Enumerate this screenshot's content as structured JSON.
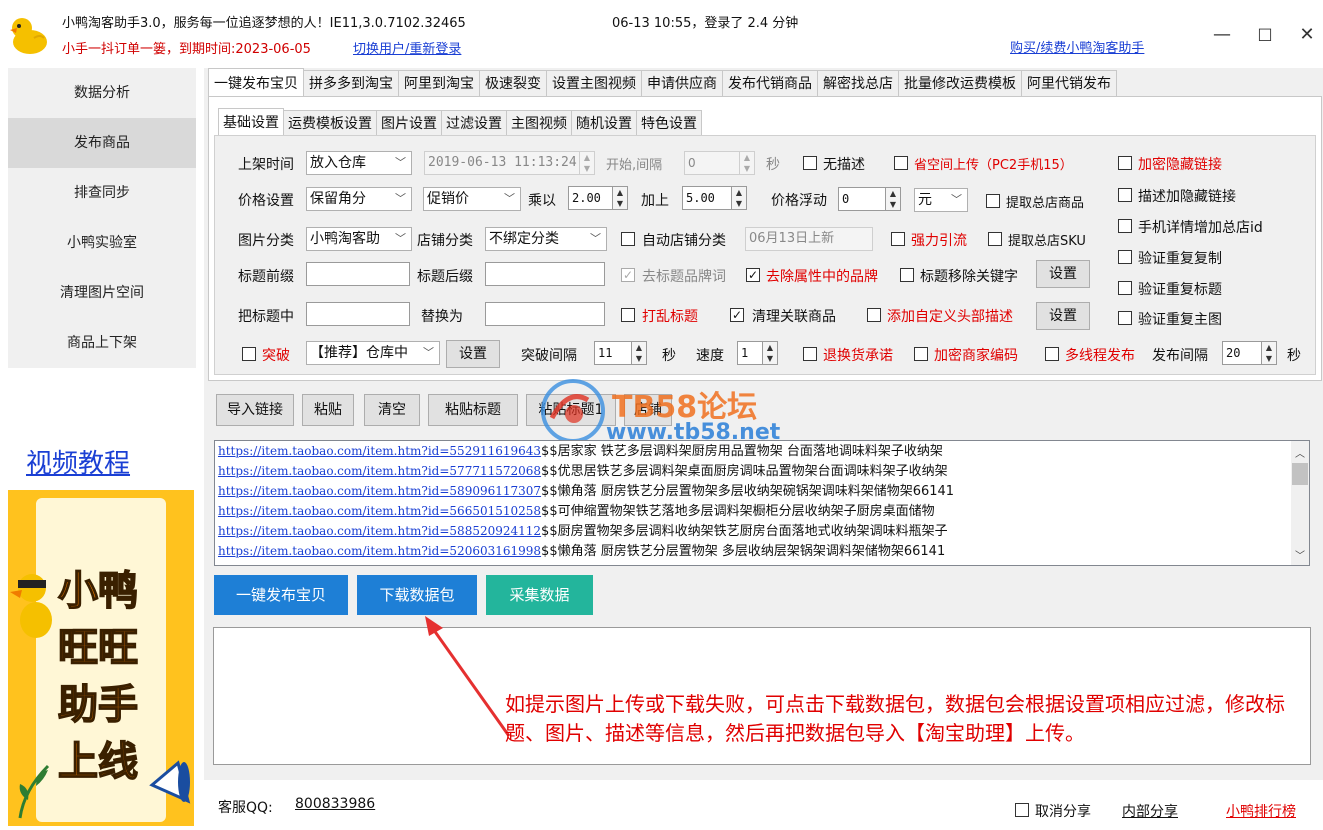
{
  "titlebar": {
    "line1": "小鸭淘客助手3.0，服务每一位追逐梦想的人！IE11,3.0.7102.32465",
    "time_info": "06-13 10:55，登录了 2.4 分钟",
    "line2": "小手一抖订单一篓，到期时间:2023-06-05",
    "switch_user": "切换用户/重新登录",
    "buy": "购买/续费小鸭淘客助手",
    "minimize": "—",
    "maximize": "□",
    "close": "✕"
  },
  "sidebar": {
    "items": [
      {
        "label": "数据分析"
      },
      {
        "label": "发布商品"
      },
      {
        "label": "排查同步"
      },
      {
        "label": "小鸭实验室"
      },
      {
        "label": "清理图片空间"
      },
      {
        "label": "商品上下架"
      }
    ],
    "video_link": "视频教程",
    "banner": {
      "l1": "小鸭",
      "l2": "旺旺",
      "l3": "助手",
      "l4": "上线"
    }
  },
  "tabs": [
    "一键发布宝贝",
    "拼多多到淘宝",
    "阿里到淘宝",
    "极速裂变",
    "设置主图视频",
    "申请供应商",
    "发布代销商品",
    "解密找总店",
    "批量修改运费模板",
    "阿里代销发布"
  ],
  "subtabs": [
    "基础设置",
    "运费模板设置",
    "图片设置",
    "过滤设置",
    "主图视频",
    "随机设置",
    "特色设置"
  ],
  "form": {
    "shelf_time_label": "上架时间",
    "shelf_time_value": "放入仓库",
    "datetime": "2019-06-13 11:13:24",
    "start_interval": "开始,间隔",
    "interval_value": "0",
    "seconds": "秒",
    "no_desc": "无描述",
    "save_space": "省空间上传（PC2手机15）",
    "encrypt_link": "加密隐藏链接",
    "price_label": "价格设置",
    "price_value": "保留角分",
    "promo_value": "促销价",
    "multiply": "乘以",
    "multiply_value": "2.00",
    "add": "加上",
    "add_value": "5.00",
    "float": "价格浮动",
    "float_value": "0",
    "unit": "元",
    "extract_store": "提取总店商品",
    "desc_hidden": "描述加隐藏链接",
    "mobile_detail": "手机详情增加总店id",
    "img_cat_label": "图片分类",
    "img_cat_value": "小鸭淘客助",
    "shop_cat_label": "店铺分类",
    "shop_cat_value": "不绑定分类",
    "auto_shop_cat": "自动店铺分类",
    "new_date": "06月13日上新",
    "strong_drain": "强力引流",
    "extract_sku": "提取总店SKU",
    "verify_copy": "验证重复复制",
    "prefix_label": "标题前缀",
    "suffix_label": "标题后缀",
    "remove_brand": "去标题品牌词",
    "remove_attr_brand": "去除属性中的品牌",
    "remove_keyword": "标题移除关键字",
    "set": "设置",
    "verify_title": "验证重复标题",
    "replace_from": "把标题中",
    "replace_to": "替换为",
    "shuffle_title": "打乱标题",
    "clear_related": "清理关联商品",
    "custom_header": "添加自定义头部描述",
    "verify_img": "验证重复主图",
    "breakthrough": "突破",
    "recommend": "【推荐】仓库中",
    "break_interval": "突破间隔",
    "break_interval_value": "11",
    "speed": "速度",
    "speed_value": "1",
    "return_promise": "退换货承诺",
    "encrypt_code": "加密商家编码",
    "multithread": "多线程发布",
    "publish_interval": "发布间隔",
    "publish_interval_value": "20"
  },
  "toolbar": [
    "导入链接",
    "粘贴",
    "清空",
    "粘贴标题",
    "粘贴标题1",
    "店铺"
  ],
  "watermark": {
    "title": "TB58论坛",
    "url": "www.tb58.net"
  },
  "urls": [
    {
      "url": "https://item.taobao.com/item.htm?id=552911619643",
      "title": "$$居家家 铁艺多层调料架厨房用品置物架 台面落地调味料架子收纳架"
    },
    {
      "url": "https://item.taobao.com/item.htm?id=577711572068",
      "title": "$$优思居铁艺多层调料架桌面厨房调味品置物架台面调味料架子收纳架"
    },
    {
      "url": "https://item.taobao.com/item.htm?id=589096117307",
      "title": "$$懒角落 厨房铁艺分层置物架多层收纳架碗锅架调味料架储物架66141"
    },
    {
      "url": "https://item.taobao.com/item.htm?id=566501510258",
      "title": "$$可伸缩置物架铁艺落地多层调料架橱柜分层收纳架子厨房桌面储物"
    },
    {
      "url": "https://item.taobao.com/item.htm?id=588520924112",
      "title": "$$厨房置物架多层调料收纳架铁艺厨房台面落地式收纳架调味料瓶架子"
    },
    {
      "url": "https://item.taobao.com/item.htm?id=520603161998",
      "title": "$$懒角落 厨房铁艺分层置物架 多层收纳层架锅架调料架储物架66141"
    }
  ],
  "actions": {
    "publish": "一键发布宝贝",
    "download": "下载数据包",
    "collect": "采集数据"
  },
  "note": "如提示图片上传或下载失败，可点击下载数据包，数据包会根据设置项相应过滤，修改标题、图片、描述等信息，然后再把数据包导入【淘宝助理】上传。",
  "footer": {
    "qq_label": "客服QQ:",
    "qq": "800833986",
    "cancel_share": "取消分享",
    "internal_share": "内部分享",
    "ranking": "小鸭排行榜"
  },
  "colors": {
    "blue_btn": "#1e7fd6",
    "teal_btn": "#23b59c",
    "red_text": "#e00000",
    "link": "#1a3fd4",
    "banner": "#ffc21e"
  }
}
